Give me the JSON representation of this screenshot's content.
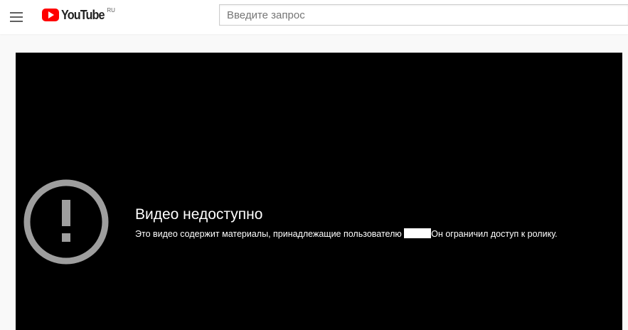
{
  "header": {
    "menu_icon": "hamburger-menu-icon",
    "logo": {
      "icon": "youtube-play-logo-icon",
      "wordmark": "YouTube",
      "region": "RU",
      "color": "#ff0000"
    },
    "search": {
      "placeholder": "Введите запрос",
      "value": ""
    }
  },
  "player": {
    "background": "#000000",
    "error_icon": "exclamation-circle-icon",
    "title": "Видео недоступно",
    "message_before": "Это видео содержит материалы, принадлежащие пользователю ",
    "message_after": "Он ограничил доступ к ролику."
  }
}
